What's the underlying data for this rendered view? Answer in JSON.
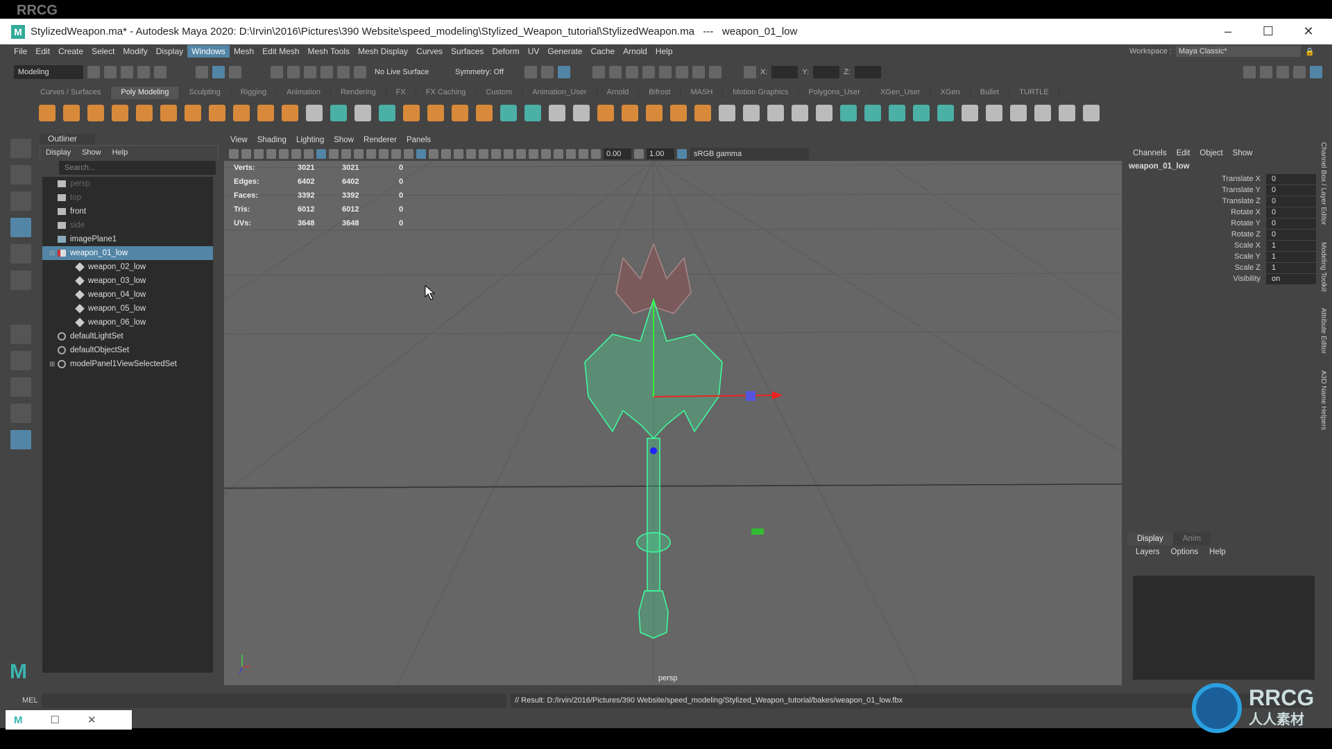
{
  "window": {
    "title": "StylizedWeapon.ma* - Autodesk Maya 2020: D:\\Irvin\\2016\\Pictures\\390 Website\\speed_modeling\\Stylized_Weapon_tutorial\\StylizedWeapon.ma   ---   weapon_01_low",
    "minimize": "–",
    "maximize": "☐",
    "close": "✕"
  },
  "menubar": [
    "File",
    "Edit",
    "Create",
    "Select",
    "Modify",
    "Display",
    "Windows",
    "Mesh",
    "Edit Mesh",
    "Mesh Tools",
    "Mesh Display",
    "Curves",
    "Surfaces",
    "Deform",
    "UV",
    "Generate",
    "Cache",
    "Arnold",
    "Help"
  ],
  "workspace": {
    "label": "Workspace :",
    "value": "Maya Classic*"
  },
  "statusline": {
    "mode": "Modeling",
    "live_surface": "No Live Surface",
    "symmetry": "Symmetry: Off",
    "x_label": "X:",
    "y_label": "Y:",
    "z_label": "Z:"
  },
  "shelf_tabs": [
    "Curves / Surfaces",
    "Poly Modeling",
    "Sculpting",
    "Rigging",
    "Animation",
    "Rendering",
    "FX",
    "FX Caching",
    "Custom",
    "Animation_User",
    "Arnold",
    "Bifrost",
    "MASH",
    "Motion Graphics",
    "Polygons_User",
    "XGen_User",
    "XGen",
    "Bullet",
    "TURTLE"
  ],
  "outliner": {
    "title": "Outliner",
    "menu": [
      "Display",
      "Show",
      "Help"
    ],
    "search_placeholder": "Search...",
    "items": [
      {
        "label": "persp",
        "icon": "camera-icon",
        "dim": true
      },
      {
        "label": "top",
        "icon": "camera-icon",
        "dim": true
      },
      {
        "label": "front",
        "icon": "camera-icon"
      },
      {
        "label": "side",
        "icon": "camera-icon",
        "dim": true
      },
      {
        "label": "imagePlane1",
        "icon": "image-plane-icon"
      },
      {
        "label": "weapon_01_low",
        "icon": "mesh-icon",
        "selected": true,
        "expand": "⊟"
      },
      {
        "label": "weapon_02_low",
        "icon": "group-icon",
        "child": true
      },
      {
        "label": "weapon_03_low",
        "icon": "group-icon",
        "child": true
      },
      {
        "label": "weapon_04_low",
        "icon": "group-icon",
        "child": true
      },
      {
        "label": "weapon_05_low",
        "icon": "group-icon",
        "child": true
      },
      {
        "label": "weapon_06_low",
        "icon": "group-icon",
        "child": true
      },
      {
        "label": "defaultLightSet",
        "icon": "set-icon"
      },
      {
        "label": "defaultObjectSet",
        "icon": "set-icon"
      },
      {
        "label": "modelPanel1ViewSelectedSet",
        "icon": "set-icon",
        "expand": "⊞"
      }
    ]
  },
  "viewport": {
    "menu": [
      "View",
      "Shading",
      "Lighting",
      "Show",
      "Renderer",
      "Panels"
    ],
    "exposure": "0.00",
    "gamma": "1.00",
    "color_space": "sRGB gamma",
    "camera": "persp",
    "hud": [
      {
        "label": "Verts:",
        "a": "3021",
        "b": "3021",
        "c": "0"
      },
      {
        "label": "Edges:",
        "a": "6402",
        "b": "6402",
        "c": "0"
      },
      {
        "label": "Faces:",
        "a": "3392",
        "b": "3392",
        "c": "0"
      },
      {
        "label": "Tris:",
        "a": "6012",
        "b": "6012",
        "c": "0"
      },
      {
        "label": "UVs:",
        "a": "3648",
        "b": "3648",
        "c": "0"
      }
    ]
  },
  "channel_box": {
    "menu": [
      "Channels",
      "Edit",
      "Object",
      "Show"
    ],
    "object": "weapon_01_low",
    "rows": [
      {
        "n": "Translate X",
        "v": "0"
      },
      {
        "n": "Translate Y",
        "v": "0"
      },
      {
        "n": "Translate Z",
        "v": "0"
      },
      {
        "n": "Rotate X",
        "v": "0"
      },
      {
        "n": "Rotate Y",
        "v": "0"
      },
      {
        "n": "Rotate Z",
        "v": "0"
      },
      {
        "n": "Scale X",
        "v": "1"
      },
      {
        "n": "Scale Y",
        "v": "1"
      },
      {
        "n": "Scale Z",
        "v": "1"
      },
      {
        "n": "Visibility",
        "v": "on"
      }
    ]
  },
  "side_tabs": [
    "Channel Box / Layer Editor",
    "Modeling Toolkit",
    "Attribute Editor",
    "A3D Name Helpers"
  ],
  "layer_editor": {
    "tabs": [
      "Display",
      "Anim"
    ],
    "menu": [
      "Layers",
      "Options",
      "Help"
    ]
  },
  "command_line": {
    "lang": "MEL",
    "result": "// Result: D:/Irvin/2016/Pictures/390 Website/speed_modeling/Stylized_Weapon_tutorial/bakes/weapon_01_low.fbx"
  },
  "watermark": {
    "top": "RRCG",
    "logo": "RRCG",
    "logo_sub": "人人素材"
  },
  "colors": {
    "selection": "#5285a6",
    "wireframe": "#3dffa0",
    "panel": "#444444",
    "viewport": "#666666"
  }
}
